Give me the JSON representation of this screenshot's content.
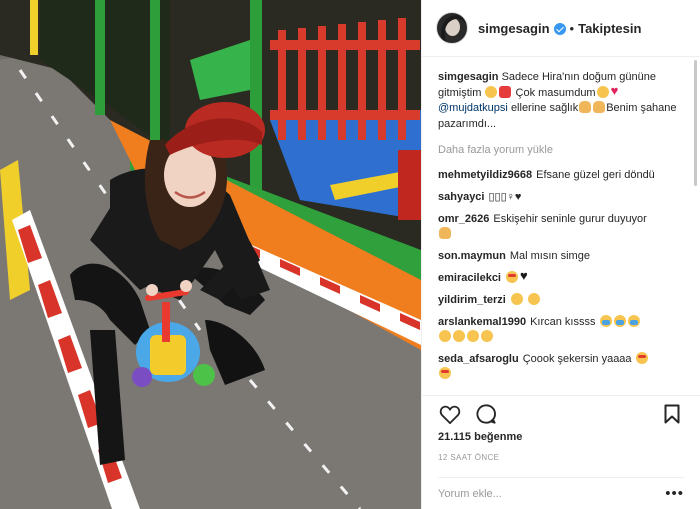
{
  "header": {
    "username": "simgesagin",
    "separator": "•",
    "follow_label": "Takiptesin"
  },
  "caption": {
    "username": "simgesagin",
    "text_1": "Sadece Hira'nın doğum gününe gitmiştim",
    "text_2": "Çok masumdum",
    "mention": "@mujdatkupsi",
    "text_3": "ellerine sağlık",
    "text_4": "Benim şahane pazarımdı..."
  },
  "load_more_label": "Daha fazla yorum yükle",
  "comments": [
    {
      "username": "mehmetyildiz9668",
      "text": "Efsane güzel geri döndü"
    },
    {
      "username": "sahyayci",
      "text": "▯▯▯♀♥"
    },
    {
      "username": "omr_2626",
      "text": "Eskişehir seninle gurur duyuyor"
    },
    {
      "username": "son.maymun",
      "text": "Mal mısın simge"
    },
    {
      "username": "emiracilekci",
      "text": ""
    },
    {
      "username": "yildirim_terzi",
      "text": ""
    },
    {
      "username": "arslankemal1990",
      "text": "Kırcan kıssss"
    },
    {
      "username": "seda_afsaroglu",
      "text": "Çoook şekersin yaaaa"
    }
  ],
  "likes_text": "21.115 beğenme",
  "timestamp": "12 SAAT ÖNCE",
  "comment_placeholder": "Yorum ekle...",
  "more_label": "•••",
  "colors": {
    "verified": "#3897f0",
    "mention": "#003569",
    "muted": "#999999"
  }
}
